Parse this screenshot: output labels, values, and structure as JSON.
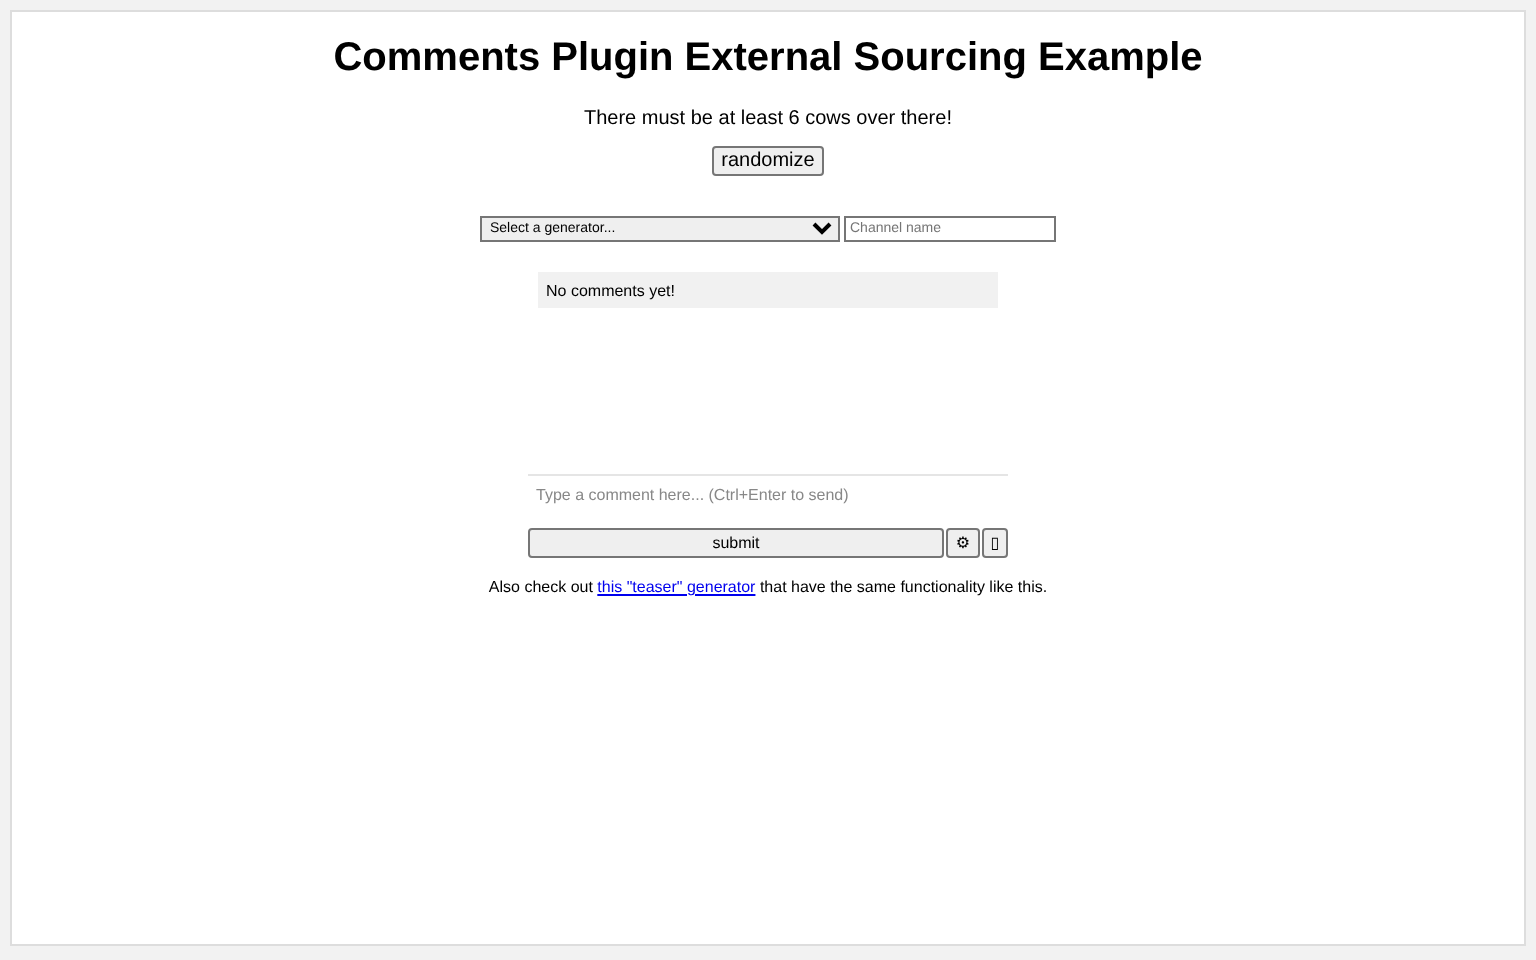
{
  "title": "Comments Plugin External Sourcing Example",
  "message": "There must be at least 6 cows over there!",
  "randomize_button": "randomize",
  "generator_select": {
    "value": "Select a generator..."
  },
  "channel_field": {
    "placeholder": "Channel name"
  },
  "comments": {
    "empty_text": "No comments yet!"
  },
  "comment_field": {
    "placeholder": "Type a comment here... (Ctrl+Enter to send)"
  },
  "buttons": [
    {
      "kind": "submit",
      "label": "submit"
    },
    {
      "kind": "icon",
      "label": "⚙"
    },
    {
      "kind": "icon",
      "label": "▯"
    }
  ],
  "note": {
    "before": "Also check out ",
    "link": "this \"teaser\" generator",
    "after": " that have the same functionality like this."
  }
}
